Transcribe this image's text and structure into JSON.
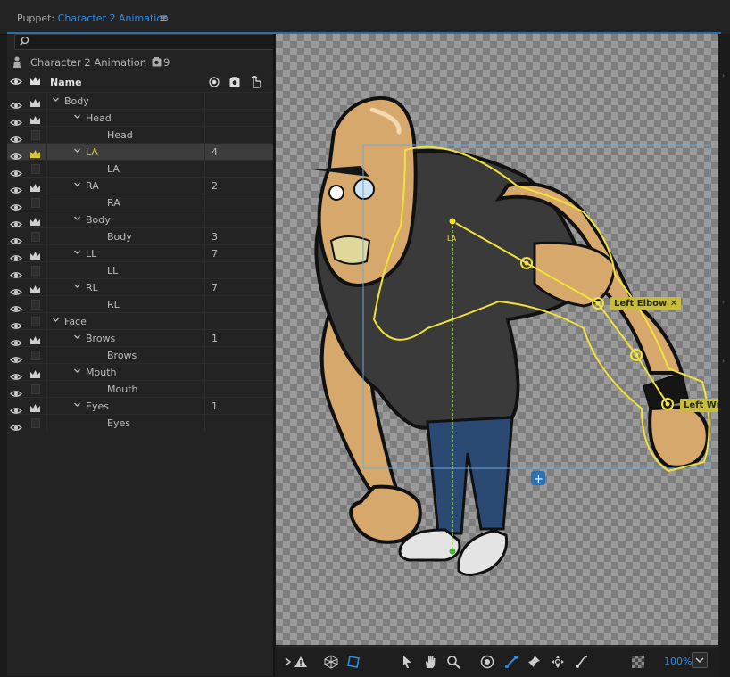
{
  "header": {
    "prefix": "Puppet: ",
    "title": "Character 2 Animation",
    "menu_icon": "hamburger-icon"
  },
  "search": {
    "placeholder": "",
    "value": ""
  },
  "puppet": {
    "name": "Character 2 Animation",
    "record_count": "9"
  },
  "columns": {
    "name": "Name"
  },
  "rows": [
    {
      "name": "Body",
      "indent": 0,
      "group": true,
      "crown": true,
      "value": ""
    },
    {
      "name": "Head",
      "indent": 1,
      "group": true,
      "crown": true,
      "value": ""
    },
    {
      "name": "Head",
      "indent": 2,
      "group": false,
      "crown": false,
      "value": ""
    },
    {
      "name": "LA",
      "indent": 1,
      "group": true,
      "crown": true,
      "value": "4",
      "selected": true
    },
    {
      "name": "LA",
      "indent": 2,
      "group": false,
      "crown": false,
      "value": ""
    },
    {
      "name": "RA",
      "indent": 1,
      "group": true,
      "crown": true,
      "value": "2"
    },
    {
      "name": "RA",
      "indent": 2,
      "group": false,
      "crown": false,
      "value": ""
    },
    {
      "name": "Body",
      "indent": 1,
      "group": true,
      "crown": true,
      "value": ""
    },
    {
      "name": "Body",
      "indent": 2,
      "group": false,
      "crown": false,
      "value": "3"
    },
    {
      "name": "LL",
      "indent": 1,
      "group": true,
      "crown": true,
      "value": "7"
    },
    {
      "name": "LL",
      "indent": 2,
      "group": false,
      "crown": false,
      "value": ""
    },
    {
      "name": "RL",
      "indent": 1,
      "group": true,
      "crown": true,
      "value": "7"
    },
    {
      "name": "RL",
      "indent": 2,
      "group": false,
      "crown": false,
      "value": ""
    },
    {
      "name": "Face",
      "indent": 0,
      "group": true,
      "crown": false,
      "value": ""
    },
    {
      "name": "Brows",
      "indent": 1,
      "group": true,
      "crown": true,
      "value": "1"
    },
    {
      "name": "Brows",
      "indent": 2,
      "group": false,
      "crown": false,
      "value": ""
    },
    {
      "name": "Mouth",
      "indent": 1,
      "group": true,
      "crown": true,
      "value": ""
    },
    {
      "name": "Mouth",
      "indent": 2,
      "group": false,
      "crown": false,
      "value": ""
    },
    {
      "name": "Eyes",
      "indent": 1,
      "group": true,
      "crown": true,
      "value": "1"
    },
    {
      "name": "Eyes",
      "indent": 2,
      "group": false,
      "crown": false,
      "value": ""
    }
  ],
  "canvas": {
    "handles": {
      "left_elbow": "Left Elbow",
      "left_wrist": "Left Wri",
      "origin_label": "LA"
    }
  },
  "toolbar": {
    "zoom": "100%",
    "icons": [
      "expand-arrow-icon",
      "warning-icon",
      "mesh-icon",
      "mesh-outline-icon",
      "select-arrow-icon",
      "hand-icon",
      "zoom-icon",
      "origin-tool-icon",
      "stick-tool-icon",
      "pin-tool-icon",
      "handle-tool-icon",
      "dangle-tool-icon",
      "transparency-grid-icon",
      "chevron-down-icon"
    ]
  },
  "colors": {
    "accent": "#2d8ceb",
    "selection": "#d8c63b",
    "handle_yellow": "#f0e23a",
    "bounding_box": "#6aa8d8"
  }
}
